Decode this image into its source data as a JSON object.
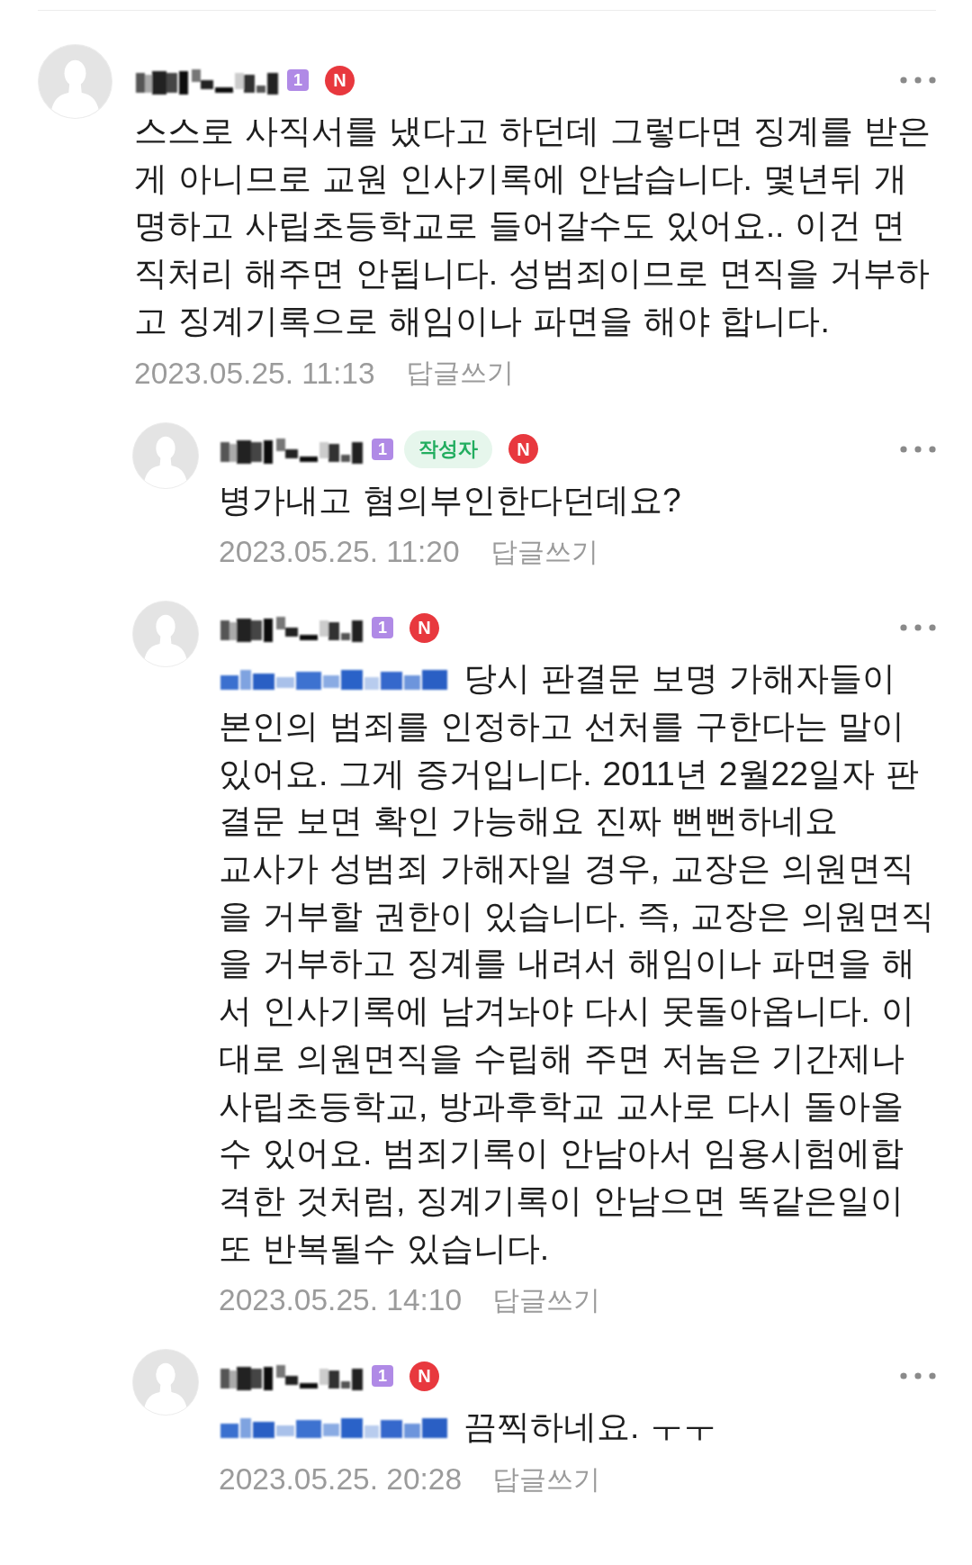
{
  "comments": [
    {
      "name_hidden": true,
      "level_badge": "1",
      "new_badge": "N",
      "text": "스스로 사직서를 냈다고 하던데 그렇다면 징계를 받은 게 아니므로 교원 인사기록에 안남습니다. 몇년뒤 개명하고 사립초등학교로 들어갈수도 있어요.. 이건 면직처리 해주면 안됩니다. 성범죄이므로 면직을 거부하고 징계기록으로 해임이나 파면을 해야 합니다.",
      "date": "2023.05.25. 11:13",
      "reply_label": "답글쓰기",
      "replies": [
        {
          "name_hidden": true,
          "level_badge": "1",
          "author_badge": "작성자",
          "new_badge": "N",
          "text": "병가내고 혐의부인한다던데요?",
          "date": "2023.05.25. 11:20",
          "reply_label": "답글쓰기"
        },
        {
          "name_hidden": true,
          "level_badge": "1",
          "new_badge": "N",
          "mention_hidden": true,
          "text": "당시 판결문 보명 가해자들이 본인의 범죄를 인정하고 선처를 구한다는 말이 있어요. 그게 증거입니다. 2011년 2월22일자 판결문 보면 확인 가능해요 진짜 뻔뻔하네요\n교사가 성범죄 가해자일 경우, 교장은 의원면직을 거부할 권한이 있습니다. 즉, 교장은 의원면직을 거부하고 징계를 내려서 해임이나 파면을 해서 인사기록에 남겨놔야 다시 못돌아옵니다. 이대로 의원면직을 수립해 주면 저놈은 기간제나 사립초등학교, 방과후학교 교사로 다시 돌아올수 있어요. 범죄기록이 안남아서 임용시험에합격한 것처럼, 징계기록이 안남으면 똑같은일이 또 반복될수 있습니다.",
          "date": "2023.05.25. 14:10",
          "reply_label": "답글쓰기"
        },
        {
          "name_hidden": true,
          "level_badge": "1",
          "new_badge": "N",
          "mention_hidden": true,
          "text": "끔찍하네요. ㅜㅜ",
          "date": "2023.05.25. 20:28",
          "reply_label": "답글쓰기"
        }
      ]
    }
  ]
}
